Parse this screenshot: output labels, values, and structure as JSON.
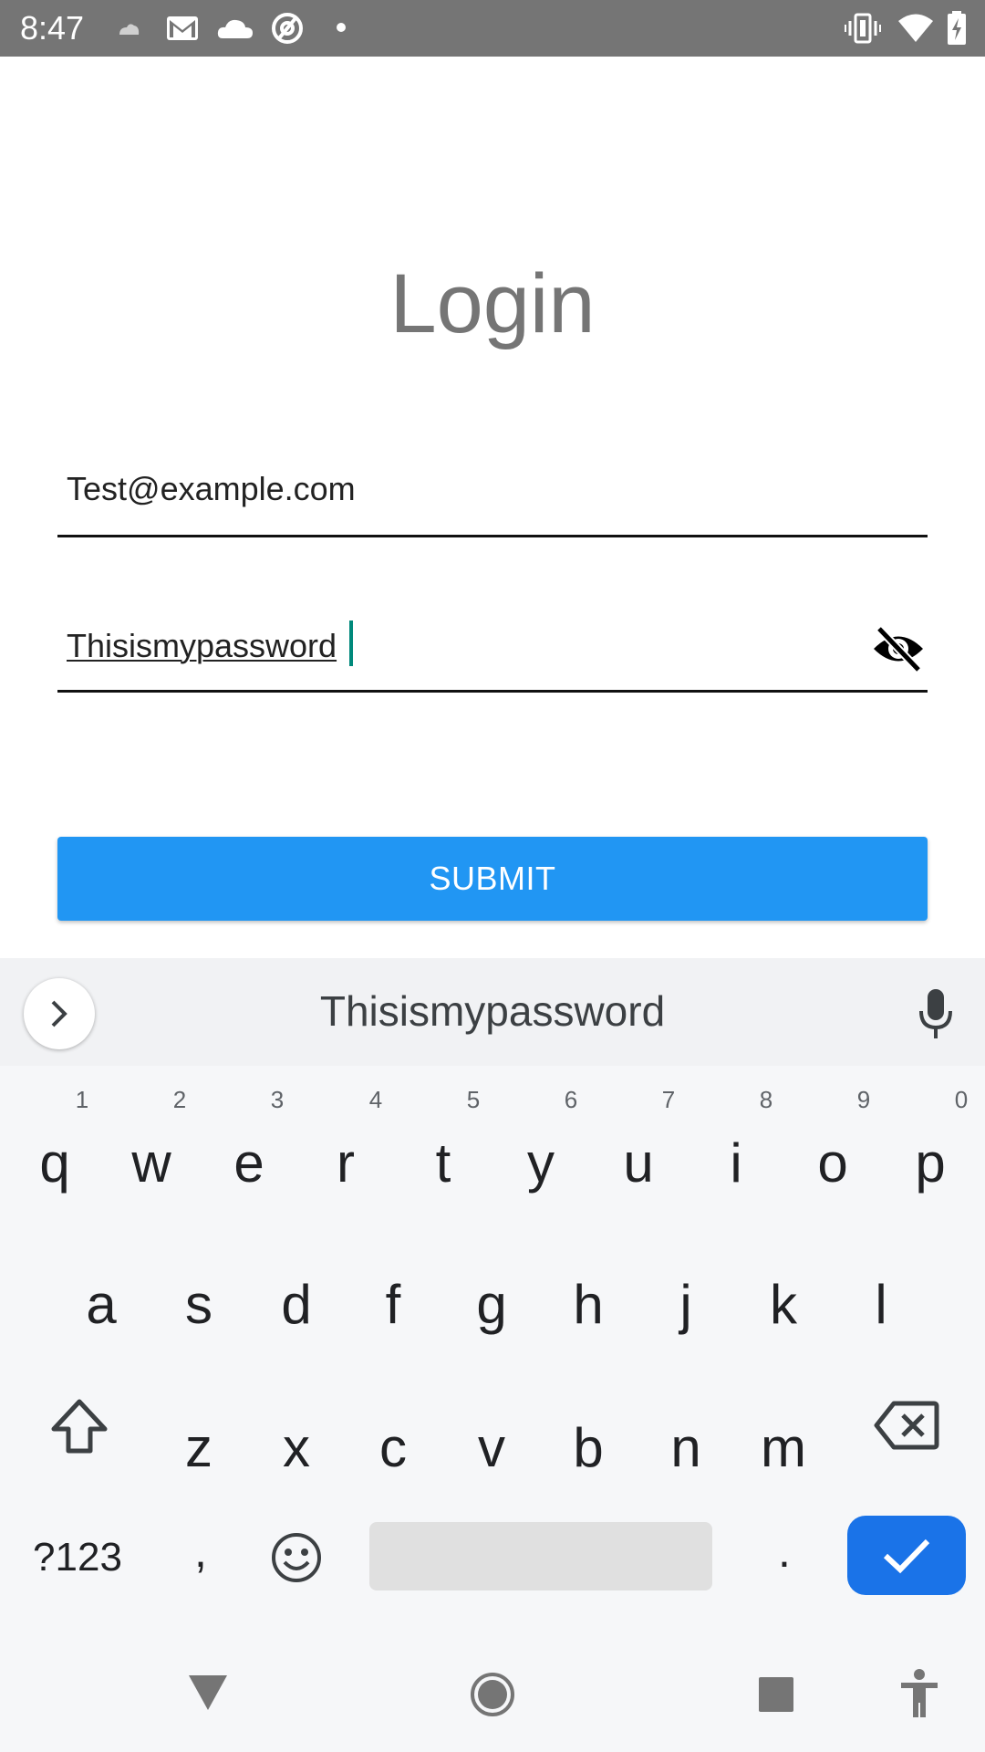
{
  "status_bar": {
    "time": "8:47",
    "left_icons": [
      "small-cloud-icon",
      "gmail-icon",
      "cloud-icon",
      "at-circle-icon",
      "dot-icon"
    ],
    "right_icons": [
      "vibrate-icon",
      "wifi-icon",
      "battery-charging-icon"
    ]
  },
  "login": {
    "title": "Login",
    "email_value": "Test@example.com",
    "password_value": "Thisismypassword",
    "toggle_icon": "visibility-off-icon",
    "submit_label": "SUBMIT"
  },
  "keyboard": {
    "suggestion": "Thisismypassword",
    "row1": [
      {
        "letter": "q",
        "hint": "1"
      },
      {
        "letter": "w",
        "hint": "2"
      },
      {
        "letter": "e",
        "hint": "3"
      },
      {
        "letter": "r",
        "hint": "4"
      },
      {
        "letter": "t",
        "hint": "5"
      },
      {
        "letter": "y",
        "hint": "6"
      },
      {
        "letter": "u",
        "hint": "7"
      },
      {
        "letter": "i",
        "hint": "8"
      },
      {
        "letter": "o",
        "hint": "9"
      },
      {
        "letter": "p",
        "hint": "0"
      }
    ],
    "row2": [
      "a",
      "s",
      "d",
      "f",
      "g",
      "h",
      "j",
      "k",
      "l"
    ],
    "row3": [
      "z",
      "x",
      "c",
      "v",
      "b",
      "n",
      "m"
    ],
    "symbols_label": "?123",
    "comma_label": ",",
    "period_label": "."
  },
  "colors": {
    "accent": "#2196f3",
    "enter_key": "#1a73e8",
    "caret": "#00897b",
    "status_bar": "#757575"
  }
}
